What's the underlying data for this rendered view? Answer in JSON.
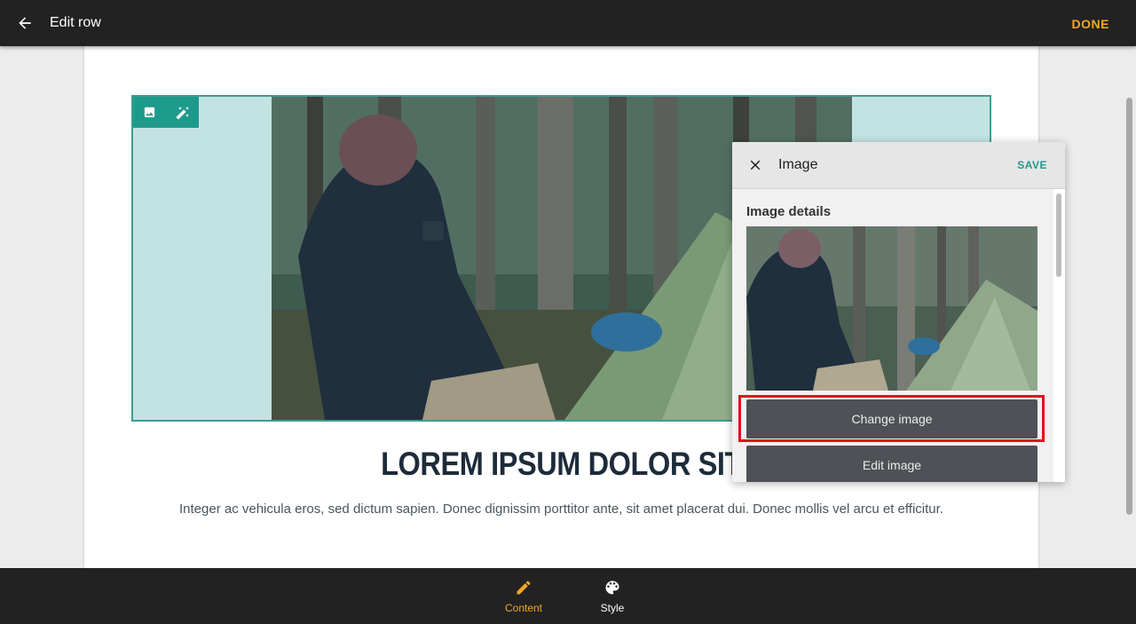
{
  "header": {
    "title": "Edit row",
    "done_label": "DONE",
    "back_icon": "arrow-left-icon"
  },
  "content": {
    "headline": "LOREM IPSUM DOLOR SIT",
    "body": "Integer ac vehicula eros, sed dictum sapien. Donec dignissim porttitor ante, sit amet placerat dui. Donec mollis vel arcu et efficitur."
  },
  "image_toolbar": {
    "icons": [
      "image-icon",
      "magic-wand-icon"
    ]
  },
  "panel": {
    "title": "Image",
    "save_label": "SAVE",
    "section_title": "Image details",
    "change_image_label": "Change image",
    "edit_image_label": "Edit image"
  },
  "bottom_nav": {
    "tabs": [
      {
        "label": "Content",
        "icon": "pencil-icon",
        "active": true
      },
      {
        "label": "Style",
        "icon": "palette-icon",
        "active": false
      }
    ]
  },
  "colors": {
    "accent": "#f5a623",
    "teal": "#1e9a8c",
    "highlight": "#e0141e",
    "bar": "#222222"
  }
}
